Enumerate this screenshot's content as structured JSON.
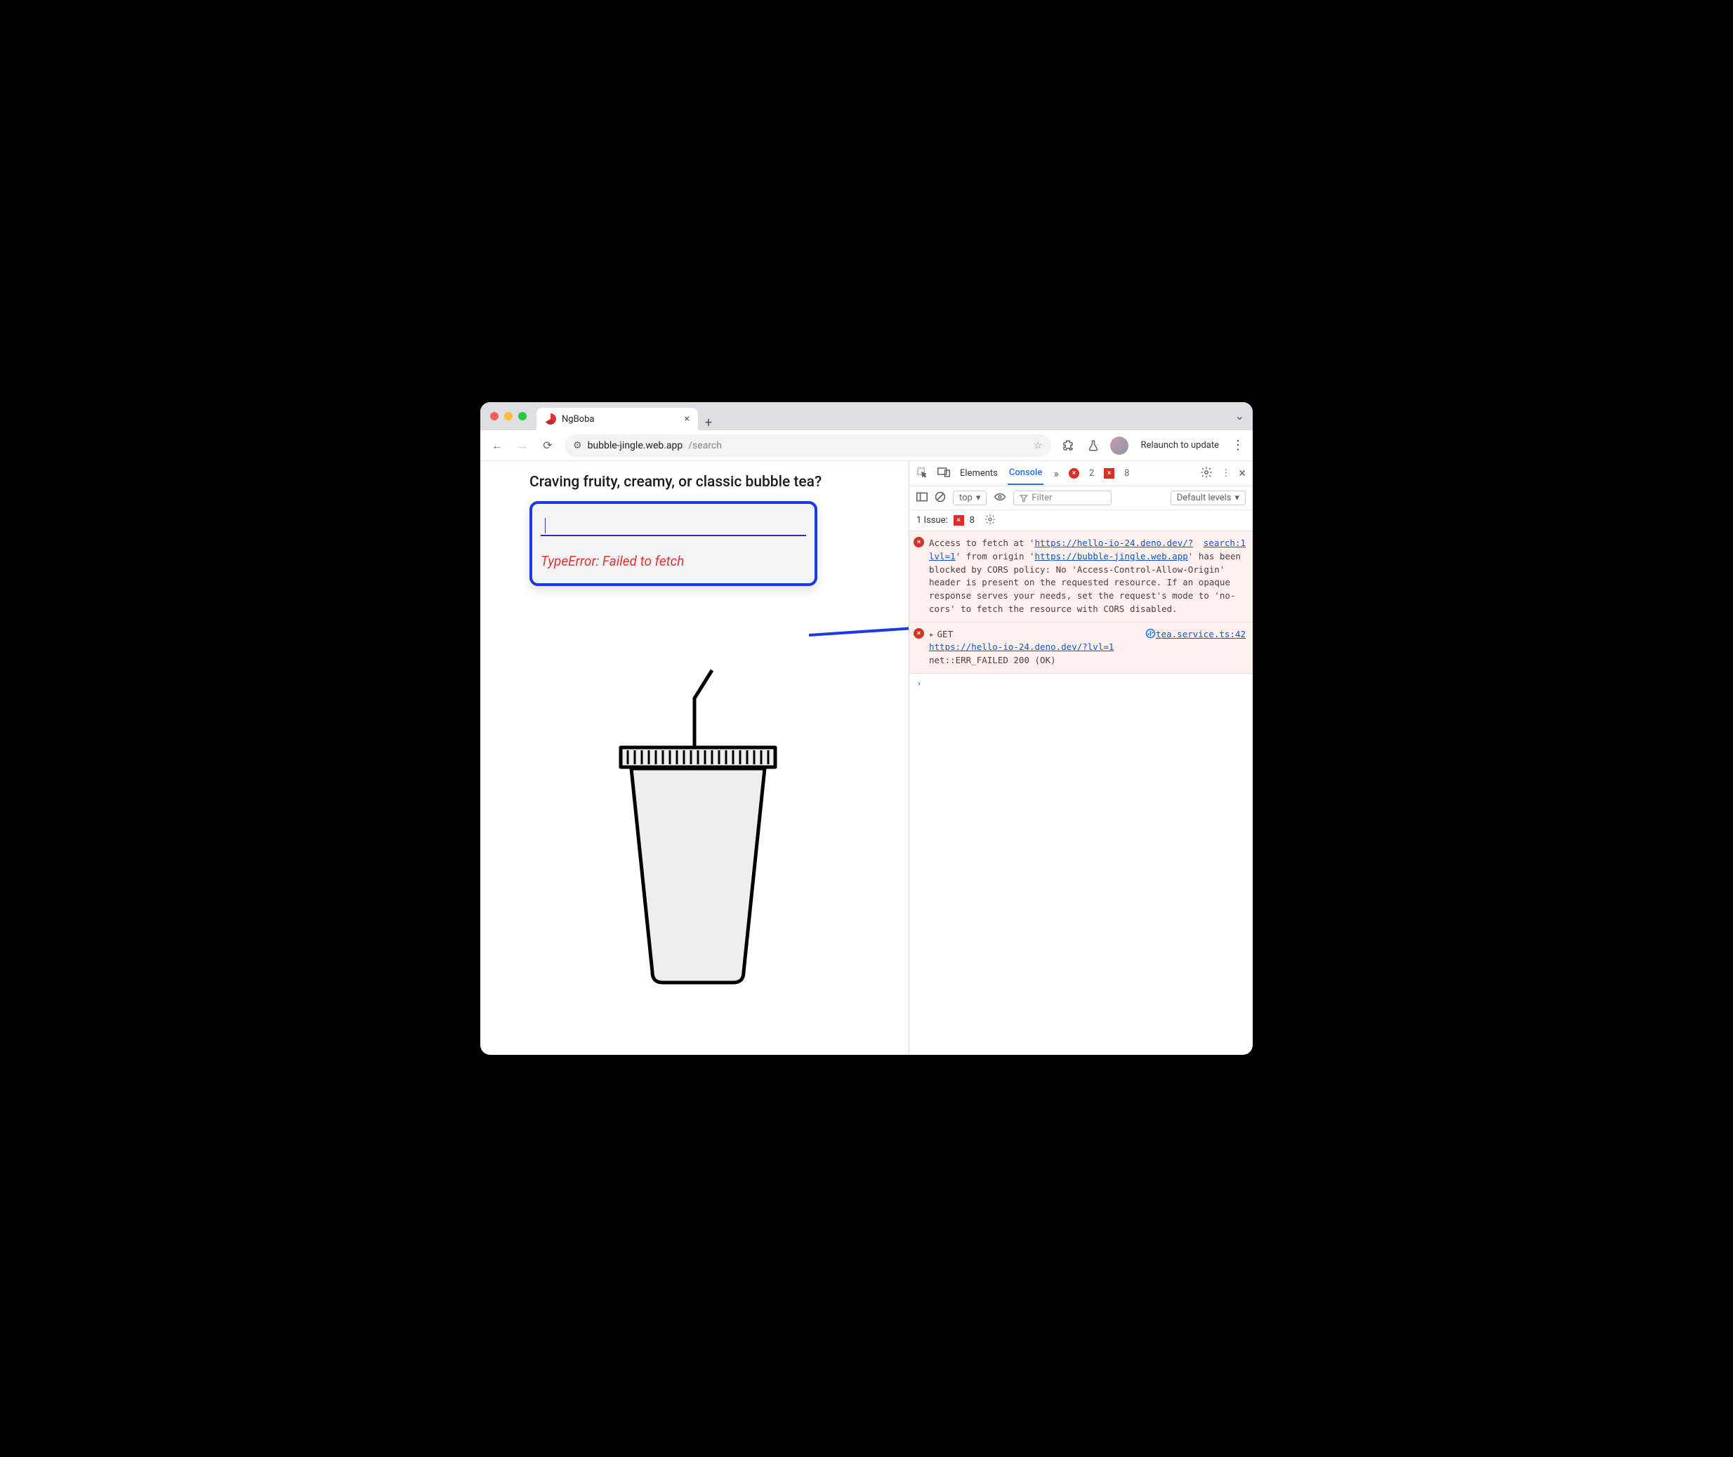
{
  "browser": {
    "tab_title": "NgBoba",
    "url_host": "bubble-jingle.web.app",
    "url_path": "/search",
    "relaunch_label": "Relaunch to update"
  },
  "page": {
    "heading": "Craving fruity, creamy, or classic bubble tea?",
    "input_value": "",
    "error_text": "TypeError: Failed to fetch"
  },
  "devtools": {
    "tab_elements": "Elements",
    "tab_console": "Console",
    "error_count": "2",
    "issue_count": "8",
    "top_label": "top",
    "filter_placeholder": "Filter",
    "levels_label": "Default levels",
    "issues_label": "1 Issue:",
    "issues_badge": "8",
    "msg1": {
      "source": "search:1",
      "p1": "Access to fetch at '",
      "url1": "https://hello-io-24.deno.dev/?lvl=1",
      "p2": "' from origin '",
      "url2": "https://bubble-jingle.web.app",
      "p3": "' has been blocked by CORS policy: No 'Access-Control-Allow-Origin' header is present on the requested resource. If an opaque response serves your needs, set the request's mode to 'no-cors' to fetch the resource with CORS disabled."
    },
    "msg2": {
      "source": "tea.service.ts:42",
      "method": "GET",
      "url": "https://hello-io-24.deno.dev/?lvl=1",
      "tail": " net::ERR_FAILED 200 (OK)"
    }
  }
}
